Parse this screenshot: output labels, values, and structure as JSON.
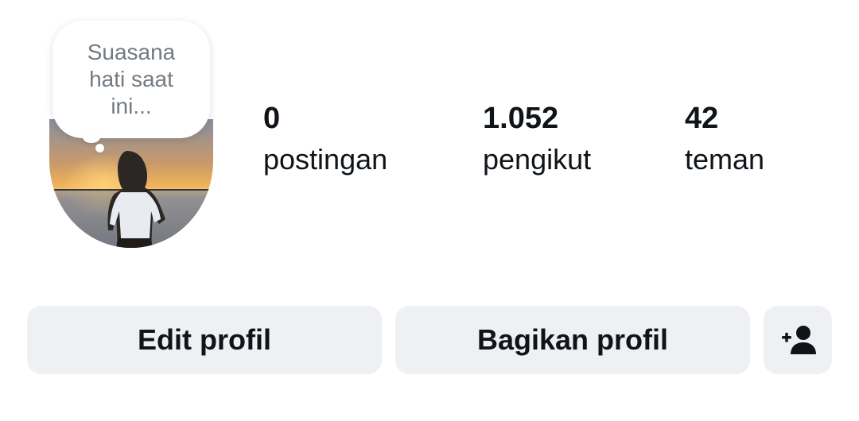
{
  "profile": {
    "note": "Suasana hati saat ini...",
    "stats": [
      {
        "value": "0",
        "label": "postingan"
      },
      {
        "value": "1.052",
        "label": "pengikut"
      },
      {
        "value": "42",
        "label": "teman"
      }
    ]
  },
  "actions": {
    "edit_label": "Edit profil",
    "share_label": "Bagikan profil",
    "add_friend_icon": "add-person-icon",
    "add_story_icon": "plus-icon"
  },
  "colors": {
    "button_bg": "#eff0f3",
    "text_primary": "#0f1419",
    "note_text": "#737a82",
    "add_badge_bg": "#0f1419"
  }
}
